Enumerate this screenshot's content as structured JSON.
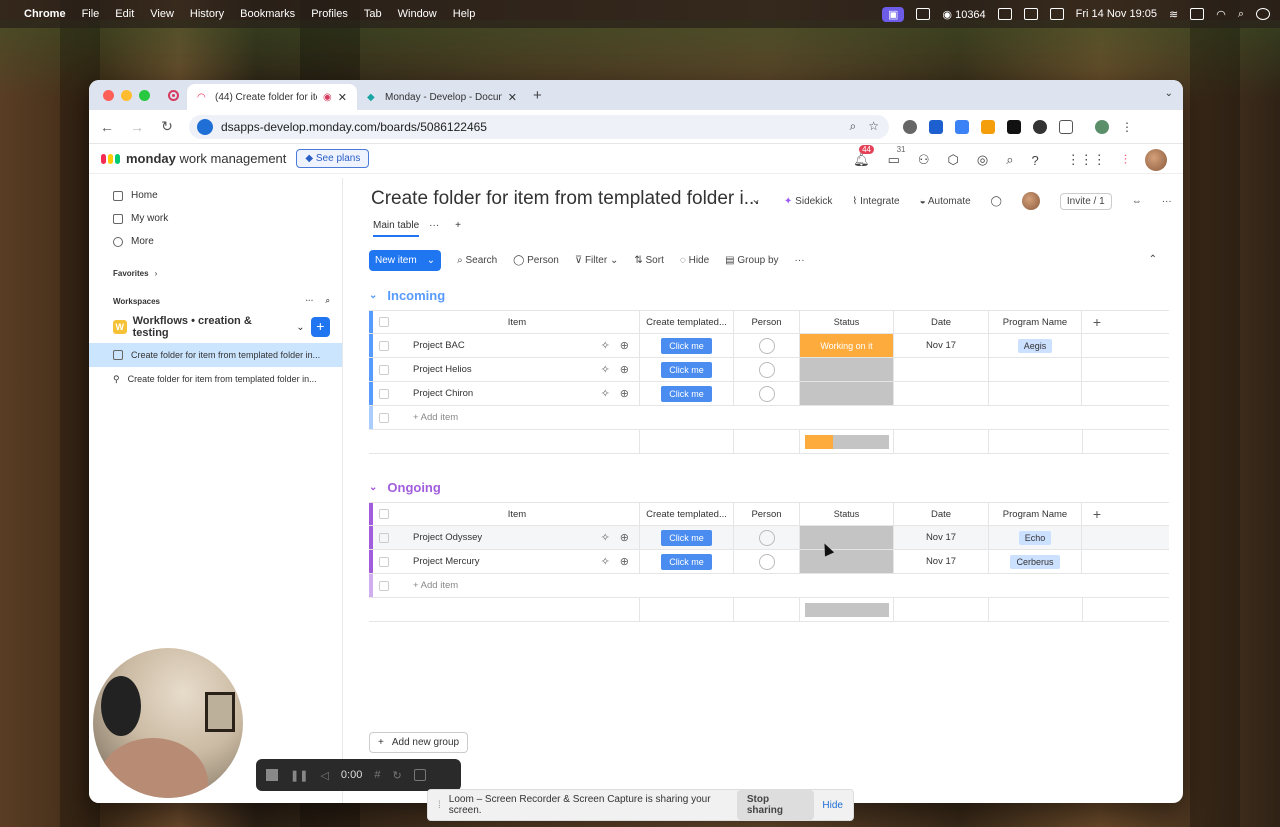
{
  "menubar": {
    "app": "Chrome",
    "items": [
      "File",
      "Edit",
      "View",
      "History",
      "Bookmarks",
      "Profiles",
      "Tab",
      "Window",
      "Help"
    ],
    "counter": "10364",
    "datetime": "Fri 14 Nov  19:05"
  },
  "browser": {
    "tabs": [
      {
        "title": "(44) Create folder for item"
      },
      {
        "title": "Monday - Develop - Documen"
      }
    ],
    "url": "dsapps-develop.monday.com/boards/5086122465"
  },
  "app": {
    "brand_bold": "monday",
    "brand_rest": " work management",
    "see_plans": "See plans",
    "notif_count": "44",
    "inbox_count": "31"
  },
  "sidebar": {
    "nav": [
      {
        "label": "Home",
        "icon": "home-icon"
      },
      {
        "label": "My work",
        "icon": "calendar-icon"
      },
      {
        "label": "More",
        "icon": "more-icon"
      }
    ],
    "favorites": "Favorites",
    "workspaces": "Workspaces",
    "workspace_badge": "W",
    "workspace_name": "Workflows • creation & testing",
    "boards": [
      {
        "label": "Create folder for item from templated folder in..."
      },
      {
        "label": "Create folder for item from templated folder in..."
      }
    ]
  },
  "board": {
    "title": "Create folder for item from templated folder i...",
    "actions": {
      "sidekick": "Sidekick",
      "integrate": "Integrate",
      "automate": "Automate",
      "invite": "Invite / 1"
    },
    "view": "Main table",
    "toolbar": {
      "new_item": "New item",
      "search": "Search",
      "person": "Person",
      "filter": "Filter",
      "sort": "Sort",
      "hide": "Hide",
      "group_by": "Group by"
    },
    "columns": [
      "Item",
      "Create templated...",
      "Person",
      "Status",
      "Date",
      "Program Name"
    ],
    "button_label": "Click me",
    "add_item": "+ Add item",
    "add_group": "Add new group",
    "groups": [
      {
        "name": "Incoming",
        "color": "#579bfc",
        "rows": [
          {
            "item": "Project BAC",
            "status": "Working on it",
            "status_color": "#fdab3d",
            "date": "Nov 17",
            "program": "Aegis"
          },
          {
            "item": "Project Helios",
            "status": "",
            "status_color": "#c4c4c4",
            "date": "",
            "program": ""
          },
          {
            "item": "Project Chiron",
            "status": "",
            "status_color": "#c4c4c4",
            "date": "",
            "program": ""
          }
        ]
      },
      {
        "name": "Ongoing",
        "color": "#a25ddc",
        "rows": [
          {
            "item": "Project Odyssey",
            "status": "",
            "status_color": "#c4c4c4",
            "date": "Nov 17",
            "program": "Echo"
          },
          {
            "item": "Project Mercury",
            "status": "",
            "status_color": "#c4c4c4",
            "date": "Nov 17",
            "program": "Cerberus"
          }
        ]
      }
    ]
  },
  "recorder": {
    "time": "0:00"
  },
  "share": {
    "message": "Loom – Screen Recorder & Screen Capture is sharing your screen.",
    "stop": "Stop sharing",
    "hide": "Hide"
  }
}
